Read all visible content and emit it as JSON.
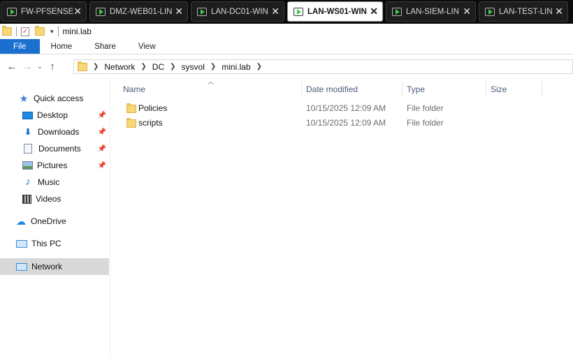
{
  "vm_tabs": [
    {
      "label": "FW-PFSENSE",
      "active": false
    },
    {
      "label": "DMZ-WEB01-LIN",
      "active": false
    },
    {
      "label": "LAN-DC01-WIN",
      "active": false
    },
    {
      "label": "LAN-WS01-WIN",
      "active": true
    },
    {
      "label": "LAN-SIEM-LIN",
      "active": false
    },
    {
      "label": "LAN-TEST-LIN",
      "active": false
    }
  ],
  "close_glyph": "✕",
  "window_title": "mini.lab",
  "ribbon": {
    "file": "File",
    "home": "Home",
    "share": "Share",
    "view": "View"
  },
  "address": {
    "crumbs": [
      "Network",
      "DC",
      "sysvol",
      "mini.lab"
    ]
  },
  "sidebar": {
    "quick_access": "Quick access",
    "items": [
      {
        "label": "Desktop",
        "icon": "desktop-icon"
      },
      {
        "label": "Downloads",
        "icon": "downloads-icon"
      },
      {
        "label": "Documents",
        "icon": "documents-icon"
      },
      {
        "label": "Pictures",
        "icon": "pictures-icon"
      },
      {
        "label": "Music",
        "icon": "music-icon"
      },
      {
        "label": "Videos",
        "icon": "videos-icon"
      }
    ],
    "onedrive": "OneDrive",
    "this_pc": "This PC",
    "network": "Network"
  },
  "columns": {
    "name": "Name",
    "date": "Date modified",
    "type": "Type",
    "size": "Size"
  },
  "files": [
    {
      "name": "Policies",
      "date": "10/15/2025 12:09 AM",
      "type": "File folder"
    },
    {
      "name": "scripts",
      "date": "10/15/2025 12:09 AM",
      "type": "File folder"
    }
  ],
  "colors": {
    "accent": "#1a6fcf",
    "selected": "#d9d9d9",
    "folder": "#f8d775"
  }
}
